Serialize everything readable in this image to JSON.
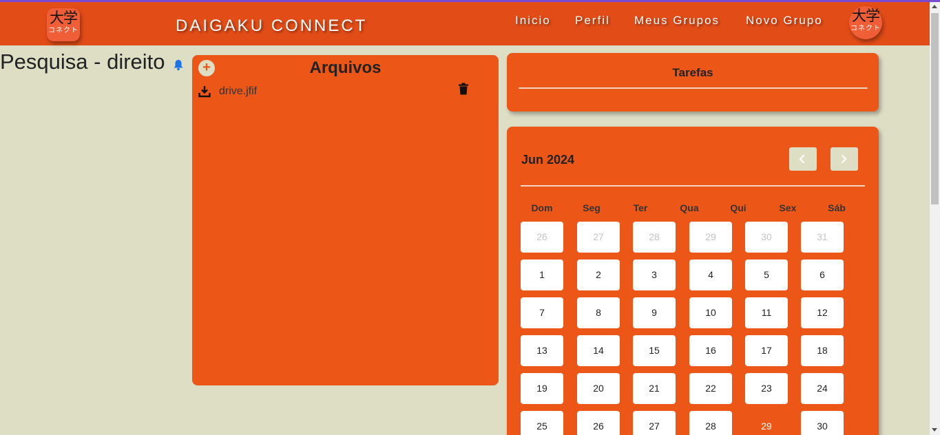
{
  "header": {
    "logo_top": "大学",
    "logo_bottom": "コネクト",
    "brand": "DAIGAKU CONNECT",
    "nav": [
      {
        "label": "Inicio"
      },
      {
        "label": "Perfil"
      },
      {
        "label": "Meus Grupos"
      },
      {
        "label": "Novo Grupo"
      }
    ]
  },
  "group": {
    "title": "Pesquisa - direito"
  },
  "files": {
    "title": "Arquivos",
    "add_label": "+",
    "items": [
      {
        "name": "drive.jfif"
      }
    ]
  },
  "tasks": {
    "title": "Tarefas"
  },
  "calendar": {
    "month_label": "Jun 2024",
    "weekdays": [
      "Dom",
      "Seg",
      "Ter",
      "Qua",
      "Qui",
      "Sex",
      "Sáb"
    ],
    "weeks": [
      [
        {
          "d": "26",
          "other": true
        },
        {
          "d": "27",
          "other": true
        },
        {
          "d": "28",
          "other": true
        },
        {
          "d": "29",
          "other": true
        },
        {
          "d": "30",
          "other": true
        },
        {
          "d": "31",
          "other": true
        }
      ],
      [
        {
          "d": "1"
        },
        {
          "d": "2"
        },
        {
          "d": "3"
        },
        {
          "d": "4"
        },
        {
          "d": "5"
        },
        {
          "d": "6"
        }
      ],
      [
        {
          "d": "7"
        },
        {
          "d": "8"
        },
        {
          "d": "9"
        },
        {
          "d": "10"
        },
        {
          "d": "11"
        },
        {
          "d": "12"
        }
      ],
      [
        {
          "d": "13"
        },
        {
          "d": "14"
        },
        {
          "d": "15"
        },
        {
          "d": "16"
        },
        {
          "d": "17"
        },
        {
          "d": "18"
        }
      ],
      [
        {
          "d": "19"
        },
        {
          "d": "20"
        },
        {
          "d": "21"
        },
        {
          "d": "22"
        },
        {
          "d": "23"
        },
        {
          "d": "24"
        }
      ],
      [
        {
          "d": "25"
        },
        {
          "d": "26"
        },
        {
          "d": "27"
        },
        {
          "d": "28"
        },
        {
          "d": "29",
          "today": true
        },
        {
          "d": "30"
        }
      ]
    ]
  },
  "colors": {
    "navbar": "#e24c17",
    "panel": "#ec5718",
    "background": "#dedec5",
    "bell": "#1a73e8"
  }
}
